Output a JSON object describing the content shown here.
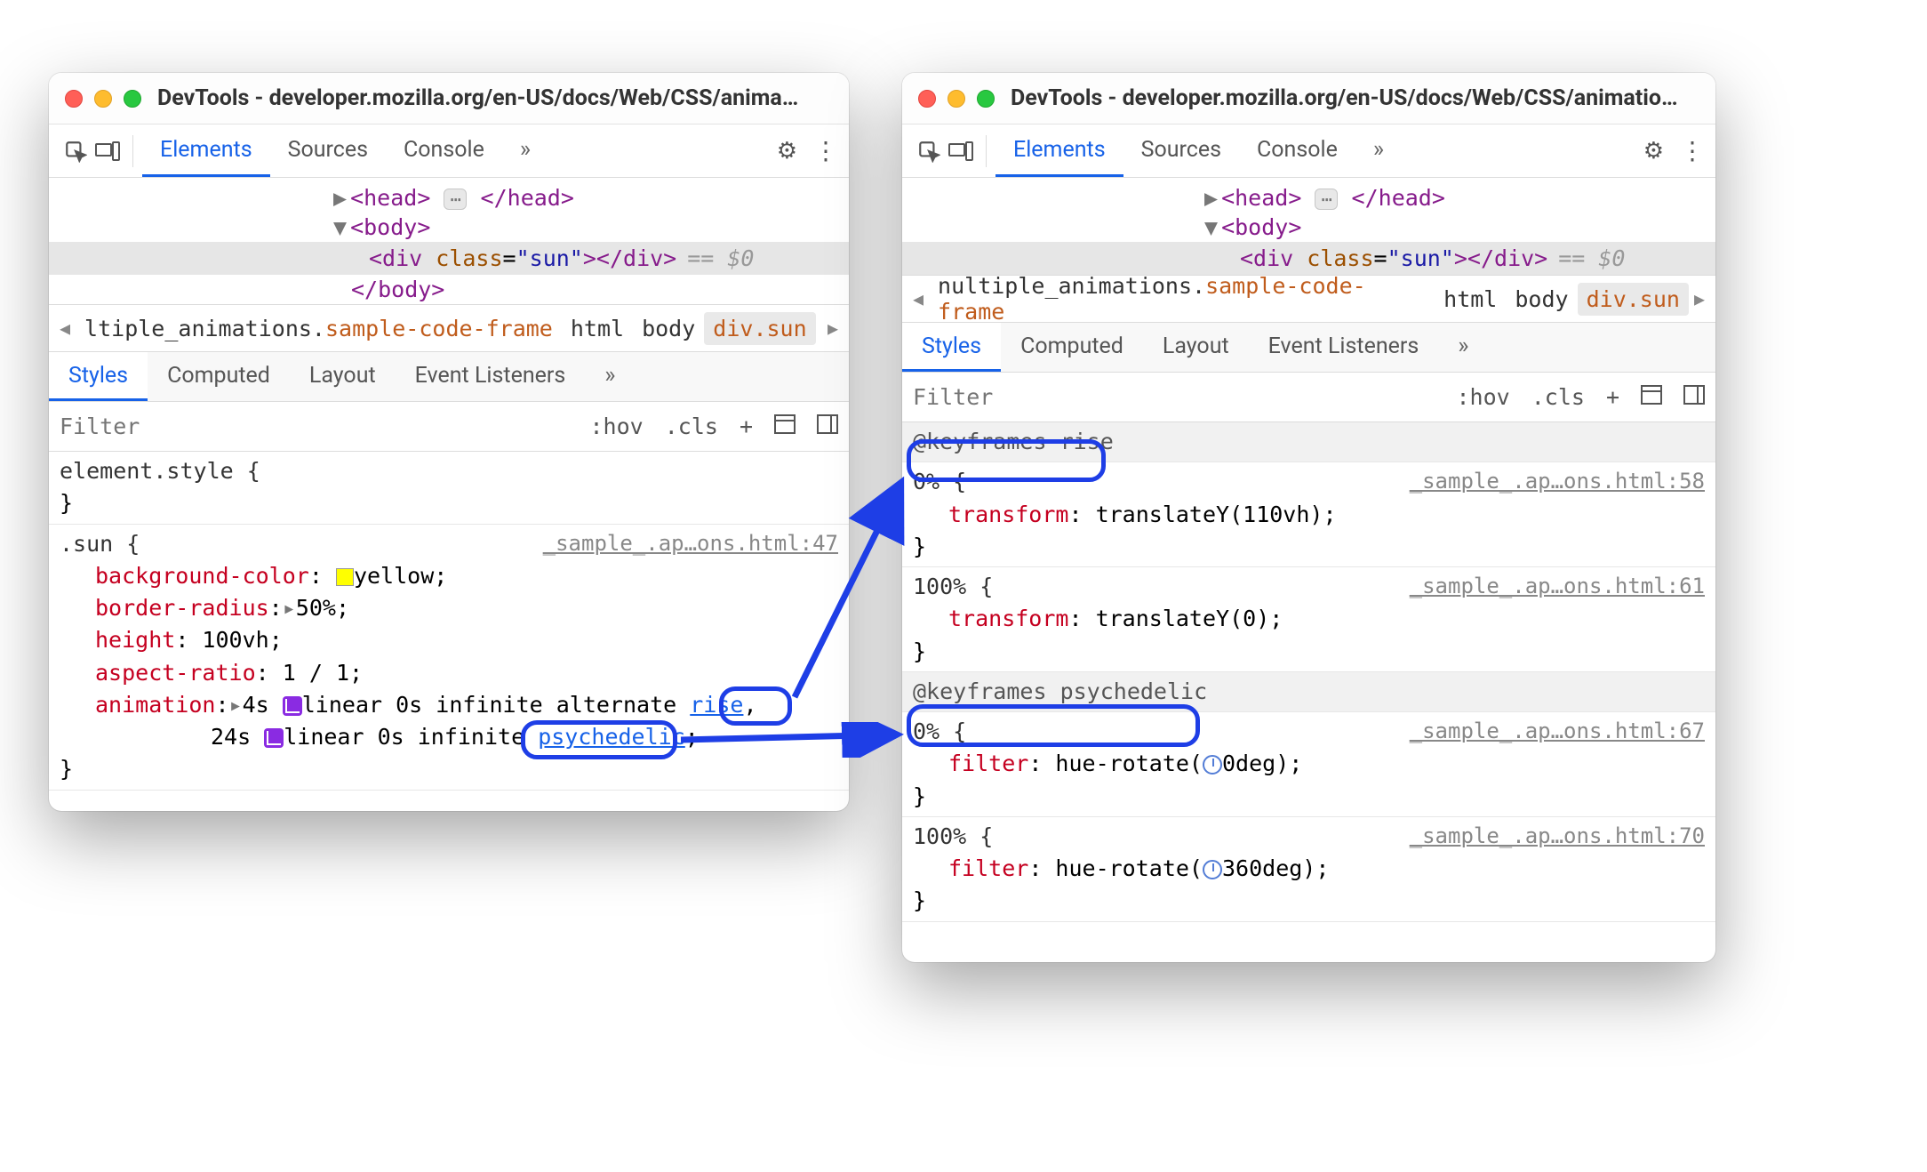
{
  "left": {
    "title": "DevTools - developer.mozilla.org/en-US/docs/Web/CSS/anima…",
    "tabs": [
      "Elements",
      "Sources",
      "Console"
    ],
    "dom": {
      "head_open": "<head>",
      "head_close": "</head>",
      "body_open": "<body>",
      "div_open1": "<div ",
      "div_attr": "class",
      "div_val": "\"sun\"",
      "div_close_outer": "></div>",
      "eq": "== $0",
      "body_close": "</body>"
    },
    "crumbs": {
      "anim": "ltiple_animations.",
      "frame": "sample-code-frame",
      "html": "html",
      "body": "body",
      "sun": "div.sun"
    },
    "subtabs": [
      "Styles",
      "Computed",
      "Layout",
      "Event Listeners"
    ],
    "filter_placeholder": "Filter",
    "filter_controls": {
      "hov": ":hov",
      "cls": ".cls",
      "plus": "+"
    },
    "styles": {
      "elstyle": "element.style {",
      "close": "}",
      "sun_sel": ".sun {",
      "sun_src": "_sample_.ap…ons.html:47",
      "bg": "background-color",
      "bg_val": "yellow",
      "radius": "border-radius",
      "radius_val": "50%",
      "height": "height",
      "height_val": "100vh",
      "aspect": "aspect-ratio",
      "aspect_val": "1 / 1",
      "anim": "animation",
      "anim_line1a": "4s ",
      "anim_line1b": "linear 0s infinite alternate ",
      "anim_rise": "rise",
      "anim_line2a": "24s ",
      "anim_line2b": "linear 0s infinite ",
      "anim_psy": "psychedelic"
    }
  },
  "right": {
    "title": "DevTools - developer.mozilla.org/en-US/docs/Web/CSS/animatio…",
    "tabs": [
      "Elements",
      "Sources",
      "Console"
    ],
    "dom": {
      "head_open": "<head>",
      "head_close": "</head>",
      "body_open": "<body>",
      "div_open1": "<div ",
      "div_attr": "class",
      "div_val": "\"sun\"",
      "div_close_outer": "></div>",
      "eq": "== $0",
      "body_close": "</body>"
    },
    "crumbs": {
      "anim": "nultiple_animations.",
      "frame": "sample-code-frame",
      "html": "html",
      "body": "body",
      "sun": "div.sun"
    },
    "subtabs": [
      "Styles",
      "Computed",
      "Layout",
      "Event Listeners"
    ],
    "filter_placeholder": "Filter",
    "filter_controls": {
      "hov": ":hov",
      "cls": ".cls",
      "plus": "+"
    },
    "keyframes": {
      "rise_hdr": "@keyframes rise",
      "rise0_sel": "0% {",
      "rise0_src": "_sample_.ap…ons.html:58",
      "rise0_prop": "transform",
      "rise0_val": "translateY(110vh)",
      "rise100_sel": "100% {",
      "rise100_src": "_sample_.ap…ons.html:61",
      "rise100_prop": "transform",
      "rise100_val": "translateY(0)",
      "psy_hdr": "@keyframes psychedelic",
      "psy0_sel": "0% {",
      "psy0_src": "_sample_.ap…ons.html:67",
      "psy0_prop": "filter",
      "psy0_val_a": "hue-rotate(",
      "psy0_val_b": "0deg)",
      "psy100_sel": "100% {",
      "psy100_src": "_sample_.ap…ons.html:70",
      "psy100_prop": "filter",
      "psy100_val_a": "hue-rotate(",
      "psy100_val_b": "360deg)",
      "close": "}"
    }
  }
}
